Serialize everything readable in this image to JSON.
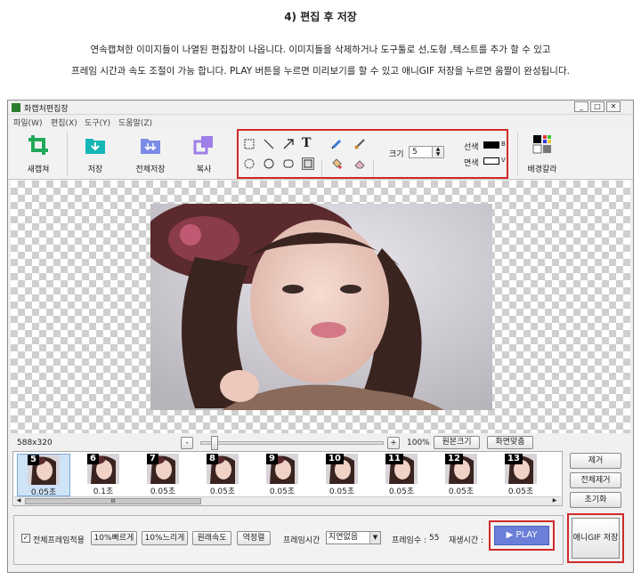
{
  "doc": {
    "heading": "4)  편집 후 저장",
    "line1": "연속캡쳐한 이미지들이 나열된 편집창이 나옵니다. 이미지들을 삭제하거나 도구툴로 선,도형 ,텍스트를 추가 할 수 있고",
    "line2": "프레임 시간과 속도 조절이 가능 합니다.  PLAY 버튼을 누르면 미리보기를 할 수 있고 애니GIF 저장을 누르면 움짤이 완성됩니다."
  },
  "window": {
    "title": "화캡처편집장",
    "controls": [
      "_",
      "□",
      "✕"
    ]
  },
  "menu": [
    "파일(W)",
    "편집(X)",
    "도구(Y)",
    "도움말(Z)"
  ],
  "toolbar": {
    "new_capture": "새캡쳐",
    "save": "저장",
    "save_all": "전체저장",
    "copy": "복사",
    "size_label": "크기",
    "size_value": "5",
    "line_color_label": "선색",
    "line_color_code": "B",
    "fill_color_label": "면색",
    "fill_color_code": "V",
    "bg_color": "배경칼라",
    "text_tool": "T"
  },
  "canvas": {
    "image_size": "588x320",
    "zoom": "100%",
    "minus": "-",
    "plus": "+",
    "zoom_slider": 0.08,
    "original_size": "원본크기",
    "fit_screen": "화면맞춤"
  },
  "frames": [
    {
      "num": "5",
      "delay": "0.05초",
      "selected": true
    },
    {
      "num": "6",
      "delay": "0.1초"
    },
    {
      "num": "7",
      "delay": "0.05초"
    },
    {
      "num": "8",
      "delay": "0.05초"
    },
    {
      "num": "9",
      "delay": "0.05초"
    },
    {
      "num": "10",
      "delay": "0.05초"
    },
    {
      "num": "11",
      "delay": "0.05초"
    },
    {
      "num": "12",
      "delay": "0.05초"
    },
    {
      "num": "13",
      "delay": "0.05초"
    }
  ],
  "scroll_grip": "III",
  "side": {
    "remove": "제거",
    "remove_all": "전체제거",
    "reset": "초기화"
  },
  "bottom": {
    "apply_all": "전체프레임적용",
    "faster": "10%빠르게",
    "slower": "10%느리게",
    "original_speed": "원래속도",
    "reverse": "역정렬",
    "frame_time_label": "프레임시간",
    "frame_time_value": "지연없음",
    "frame_count_label": "프레임수 :",
    "frame_count_value": "55",
    "play_time_label": "재생시간 :",
    "play": "▶ PLAY",
    "save_gif": "애니GIF 저장"
  },
  "colors": {
    "highlight": "#d12a2a",
    "play_button": "#6b7fd8",
    "icon_green": "#21a95a",
    "icon_teal": "#16b6b6",
    "icon_blue": "#7b8be6",
    "icon_purple": "#a07ee8"
  }
}
